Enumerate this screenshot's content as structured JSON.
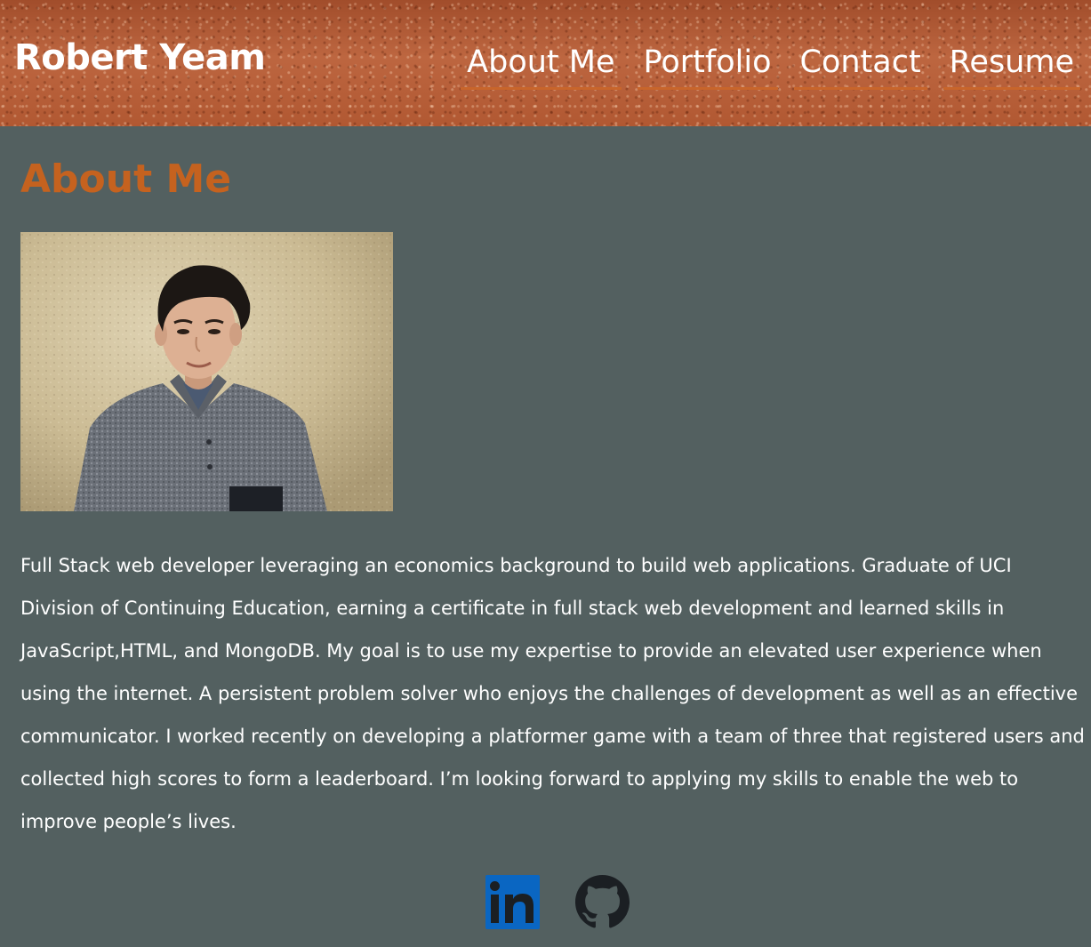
{
  "header": {
    "brand": "Robert Yeam",
    "nav": [
      {
        "label": "About Me"
      },
      {
        "label": "Portfolio"
      },
      {
        "label": "Contact"
      },
      {
        "label": "Resume"
      }
    ]
  },
  "about": {
    "title": "About Me",
    "bio": "Full Stack web developer leveraging an economics background to build web applications. Graduate of UCI Division of Continuing Education, earning a certificate in full stack web development and learned skills in JavaScript,HTML, and MongoDB. My goal is to use my expertise to provide an elevated user experience when using the internet. A persistent problem solver who enjoys the challenges of development as well as an effective communicator. I worked recently on developing a platformer game with a team of three that registered users and collected high scores to form a leaderboard. I’m looking forward to applying my skills to enable the web to improve people’s lives."
  },
  "social": {
    "linkedin": {
      "icon": "linkedin-icon",
      "text": "in",
      "color": "#0a66c2"
    },
    "github": {
      "icon": "github-icon",
      "color": "#1b1f23"
    }
  },
  "colors": {
    "background": "#536060",
    "accent": "#c5621f",
    "header": "#b55b34",
    "text": "#ffffff"
  }
}
